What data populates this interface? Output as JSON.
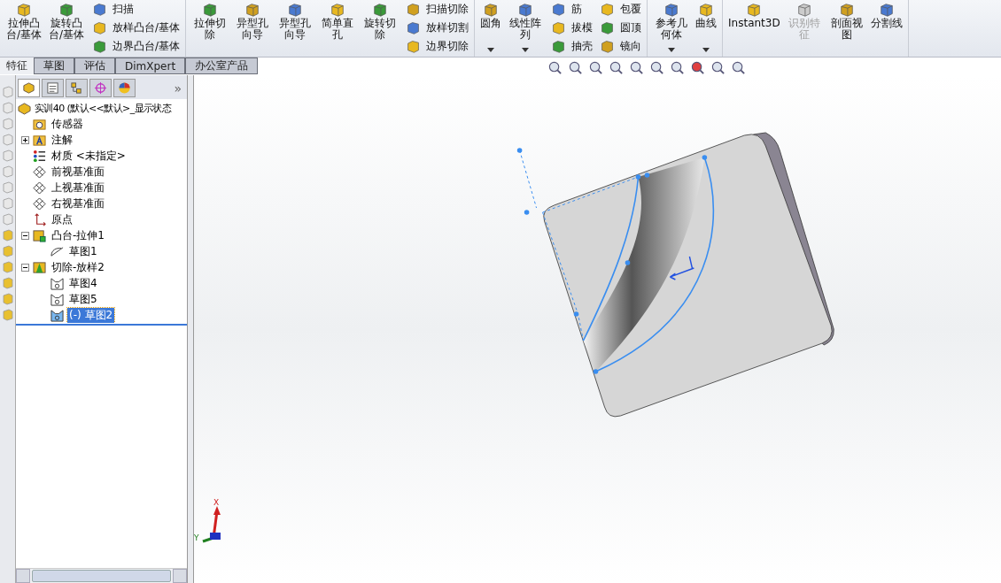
{
  "toolbar": {
    "sections": [
      {
        "columns": [
          {
            "kind": "large",
            "label": "拉伸凸台/基体"
          },
          {
            "kind": "large",
            "label": "旋转凸台/基体"
          },
          {
            "kind": "stack",
            "items": [
              {
                "label": "扫描"
              },
              {
                "label": "放样凸台/基体"
              },
              {
                "label": "边界凸台/基体"
              }
            ]
          }
        ]
      },
      {
        "columns": [
          {
            "kind": "large",
            "label": "拉伸切除"
          },
          {
            "kind": "large",
            "label": "异型孔向导"
          },
          {
            "kind": "large",
            "label": "异型孔向导"
          },
          {
            "kind": "large",
            "label": "简单直孔"
          },
          {
            "kind": "large",
            "label": "旋转切除"
          },
          {
            "kind": "stack",
            "items": [
              {
                "label": "扫描切除"
              },
              {
                "label": "放样切割"
              },
              {
                "label": "边界切除"
              }
            ]
          }
        ]
      },
      {
        "columns": [
          {
            "kind": "large",
            "label": "圆角",
            "dropdown": true
          },
          {
            "kind": "large",
            "label": "线性阵列",
            "dropdown": true
          },
          {
            "kind": "stack",
            "items": [
              {
                "label": "筋"
              },
              {
                "label": "拔模"
              },
              {
                "label": "抽壳"
              }
            ]
          },
          {
            "kind": "stack",
            "items": [
              {
                "label": "包覆"
              },
              {
                "label": "圆顶"
              },
              {
                "label": "镜向"
              }
            ]
          }
        ]
      },
      {
        "columns": [
          {
            "kind": "large",
            "label": "参考几何体",
            "dropdown": true
          },
          {
            "kind": "large",
            "label": "曲线",
            "dropdown": true
          }
        ]
      },
      {
        "columns": [
          {
            "kind": "large",
            "label": "Instant3D",
            "disabled": false
          },
          {
            "kind": "large",
            "label": "识别特征",
            "disabled": true
          },
          {
            "kind": "large",
            "label": "剖面视图",
            "disabled": false
          },
          {
            "kind": "large",
            "label": "分割线",
            "disabled": false
          }
        ]
      }
    ]
  },
  "command_tabs": [
    {
      "label": "特征",
      "selected": true
    },
    {
      "label": "草图",
      "selected": false
    },
    {
      "label": "评估",
      "selected": false
    },
    {
      "label": "DimXpert",
      "selected": false
    },
    {
      "label": "办公室产品",
      "selected": false
    }
  ],
  "feature_tree": {
    "panel_tabs": [
      {
        "kind": "tree",
        "selected": true
      },
      {
        "kind": "property",
        "selected": false
      },
      {
        "kind": "config",
        "selected": false
      },
      {
        "kind": "target",
        "selected": false
      },
      {
        "kind": "appearance",
        "selected": false
      }
    ],
    "more": "»",
    "items": [
      {
        "kind": "part",
        "label": "实训40 (默认<<默认>_显示状态",
        "selected": false,
        "children": [
          {
            "kind": "sensor",
            "label": "传感器",
            "selected": false
          },
          {
            "kind": "annotation",
            "label": "注解",
            "selected": false,
            "expanded": false
          },
          {
            "kind": "material",
            "label": "材质 <未指定>",
            "selected": false
          },
          {
            "kind": "plane",
            "label": "前视基准面",
            "selected": false
          },
          {
            "kind": "plane",
            "label": "上视基准面",
            "selected": false
          },
          {
            "kind": "plane",
            "label": "右视基准面",
            "selected": false
          },
          {
            "kind": "origin",
            "label": "原点",
            "selected": false
          },
          {
            "kind": "extrude",
            "label": "凸台-拉伸1",
            "selected": false,
            "expanded": true,
            "children": [
              {
                "kind": "sketch",
                "label": "草图1",
                "selected": false
              }
            ]
          },
          {
            "kind": "loft",
            "label": "切除-放样2",
            "selected": false,
            "expanded": true,
            "children": [
              {
                "kind": "profile",
                "label": "草图4",
                "selected": false
              },
              {
                "kind": "profile",
                "label": "草图5",
                "selected": false
              },
              {
                "kind": "profile",
                "label": "(-) 草图2",
                "selected": true
              }
            ]
          }
        ]
      }
    ]
  },
  "triad": {
    "labels": [
      "X",
      "Y"
    ]
  }
}
